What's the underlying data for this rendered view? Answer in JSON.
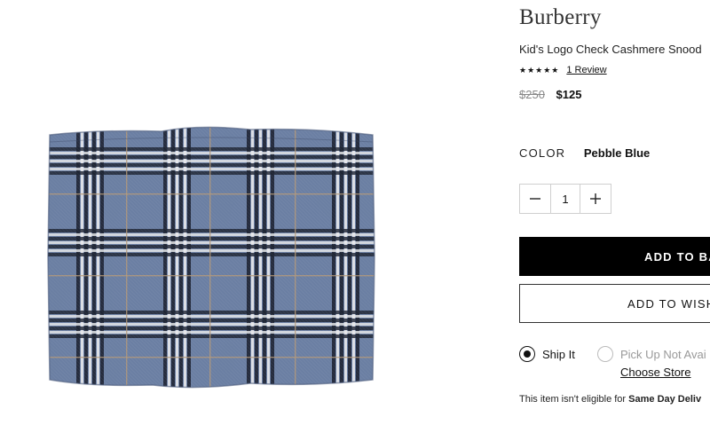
{
  "product": {
    "brand": "Burberry",
    "title": "Kid's Logo Check Cashmere Snood",
    "rating_stars": "★★★★★",
    "rating_value": 5,
    "review_link": "1 Review",
    "original_price": "$250",
    "sale_price": "$125",
    "image_alt": "Blue check cashmere snood"
  },
  "color": {
    "label": "COLOR",
    "value": "Pebble Blue",
    "swatch_colors": {
      "base": "#6b7fa3",
      "dark_stripe": "#2d3447",
      "navy_stripe": "#1e2433",
      "white_stripe": "#e8e9ec",
      "tan_stripe": "#b59a78"
    }
  },
  "quantity": {
    "minus_icon": "minus-icon",
    "plus_icon": "plus-icon",
    "value": "1"
  },
  "buttons": {
    "add_to_bag": "ADD TO BA",
    "add_to_wishlist": "ADD TO WISH"
  },
  "delivery": {
    "ship_label": "Ship It",
    "ship_selected": true,
    "pickup_label": "Pick Up Not Avai",
    "pickup_selected": false,
    "choose_store": "Choose Store",
    "eligibility_text": "This item isn't eligible for ",
    "eligibility_bold": "Same Day Deliv"
  }
}
